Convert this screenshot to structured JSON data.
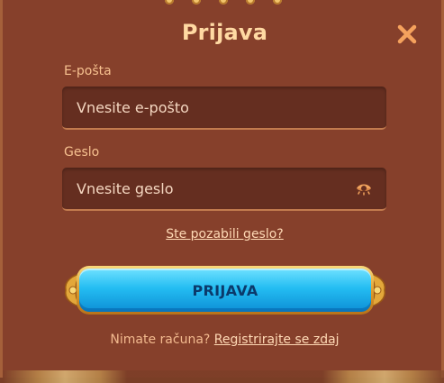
{
  "dialog": {
    "title": "Prijava",
    "close_icon": "close-icon"
  },
  "email": {
    "label": "E-pošta",
    "placeholder": "Vnesite e-pošto",
    "value": ""
  },
  "password": {
    "label": "Geslo",
    "placeholder": "Vnesite geslo",
    "value": "",
    "toggle_icon": "eye-icon"
  },
  "forgot_password": "Ste pozabili geslo?",
  "login_button": "PRIJAVA",
  "register": {
    "prompt": "Nimate računa?",
    "link": "Registrirajte se zdaj"
  },
  "colors": {
    "background": "#86402b",
    "title": "#ffd9a3",
    "label": "#f6c08f",
    "input_bg": "#652e20",
    "close_icon": "#f5a25d",
    "button_blue": "#24bdf2",
    "button_gold": "#d99a2d",
    "button_text": "#0b3a6b"
  }
}
